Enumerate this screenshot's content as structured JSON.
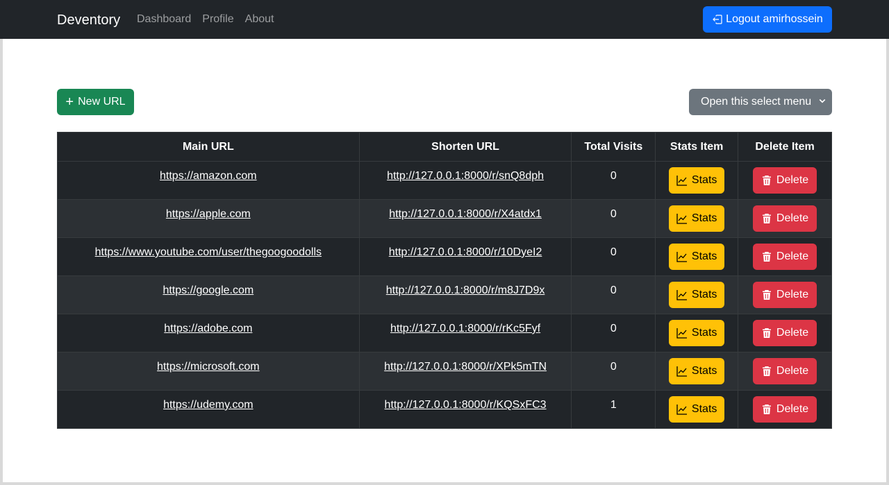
{
  "navbar": {
    "brand": "Deventory",
    "links": [
      "Dashboard",
      "Profile",
      "About"
    ],
    "logout_label": "Logout amirhossein",
    "logout_icon": "box-arrow-left-icon"
  },
  "toolbar": {
    "new_url_label": "New URL",
    "new_url_icon": "plus-icon",
    "select_value": "Open this select menu"
  },
  "table": {
    "headers": [
      "Main URL",
      "Shorten URL",
      "Total Visits",
      "Stats Item",
      "Delete Item"
    ],
    "stats_label": "Stats",
    "delete_label": "Delete",
    "rows": [
      {
        "main_url": "https://amazon.com",
        "short_url": "http://127.0.0.1:8000/r/snQ8dph",
        "visits": "0"
      },
      {
        "main_url": "https://apple.com",
        "short_url": "http://127.0.0.1:8000/r/X4atdx1",
        "visits": "0"
      },
      {
        "main_url": "https://www.youtube.com/user/thegoogoodolls",
        "short_url": "http://127.0.0.1:8000/r/10DyeI2",
        "visits": "0"
      },
      {
        "main_url": "https://google.com",
        "short_url": "http://127.0.0.1:8000/r/m8J7D9x",
        "visits": "0"
      },
      {
        "main_url": "https://adobe.com",
        "short_url": "http://127.0.0.1:8000/r/rKc5Fyf",
        "visits": "0"
      },
      {
        "main_url": "https://microsoft.com",
        "short_url": "http://127.0.0.1:8000/r/XPk5mTN",
        "visits": "0"
      },
      {
        "main_url": "https://udemy.com",
        "short_url": "http://127.0.0.1:8000/r/KQSxFC3",
        "visits": "1"
      }
    ]
  },
  "colors": {
    "navbar_bg": "#212529",
    "primary": "#0d6efd",
    "success": "#198754",
    "secondary": "#6c757d",
    "warning": "#ffc107",
    "danger": "#dc3545"
  }
}
